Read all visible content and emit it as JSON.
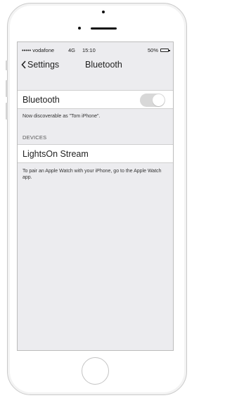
{
  "status_bar": {
    "carrier": "••••• vodafone",
    "network": "4G",
    "time": "15:10",
    "battery_percent": "50%",
    "battery_level": 0.5
  },
  "nav": {
    "back_label": "Settings",
    "title": "Bluetooth"
  },
  "bluetooth": {
    "label": "Bluetooth",
    "enabled": true,
    "discoverable_text": "Now discoverable as \"Tom iPhone\"."
  },
  "devices": {
    "header": "DEVICES",
    "items": [
      {
        "name": "LightsOn Stream"
      }
    ],
    "footer_text": "To pair an Apple Watch with your iPhone, go to the Apple Watch app."
  },
  "colors": {
    "background": "#ececef",
    "toggle_track": "#d8d8d8",
    "cell": "#ffffff"
  },
  "icons": {
    "back": "chevron-left-icon",
    "battery": "battery-icon"
  }
}
